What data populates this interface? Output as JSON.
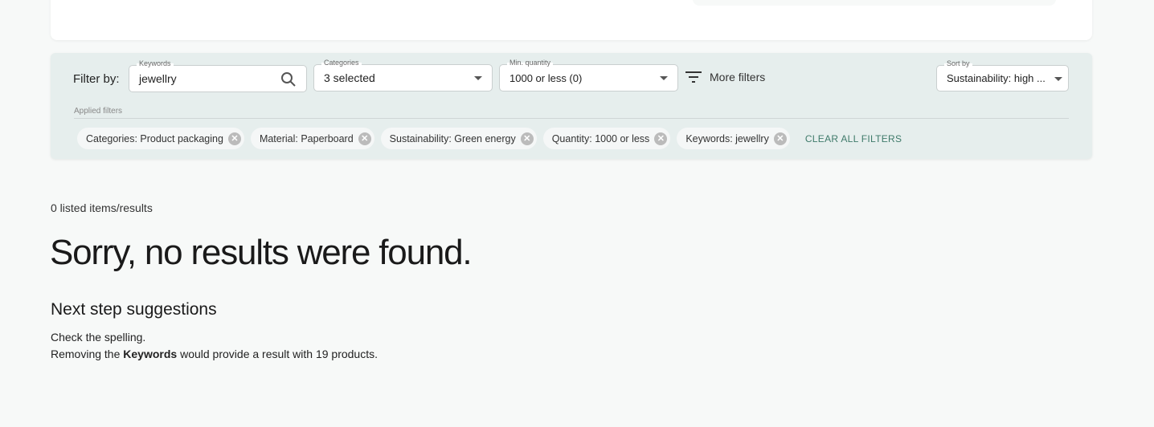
{
  "filter": {
    "filter_by": "Filter by:",
    "keywords": {
      "label": "Keywords",
      "value": "jewellry"
    },
    "categories": {
      "label": "Categories",
      "value": "3 selected"
    },
    "min_quantity": {
      "label": "Min. quantity",
      "value": "1000 or less (0)"
    },
    "more_filters": "More filters",
    "sort": {
      "label": "Sort by",
      "value": "Sustainability: high ..."
    },
    "applied_label": "Applied filters",
    "chips": [
      "Categories: Product packaging",
      "Material: Paperboard",
      "Sustainability: Green energy",
      "Quantity: 1000 or less",
      "Keywords: jewellry"
    ],
    "clear_all": "CLEAR ALL FILTERS"
  },
  "results": {
    "count": "0 listed items/results",
    "heading": "Sorry, no results were found.",
    "suggest_title": "Next step suggestions",
    "line1": "Check the spelling.",
    "line2_pre": "Removing the ",
    "line2_bold": "Keywords",
    "line2_post": " would provide a result with 19 products."
  },
  "colors": {
    "panel": "#e6eeed",
    "accent": "#3f7a6a"
  }
}
